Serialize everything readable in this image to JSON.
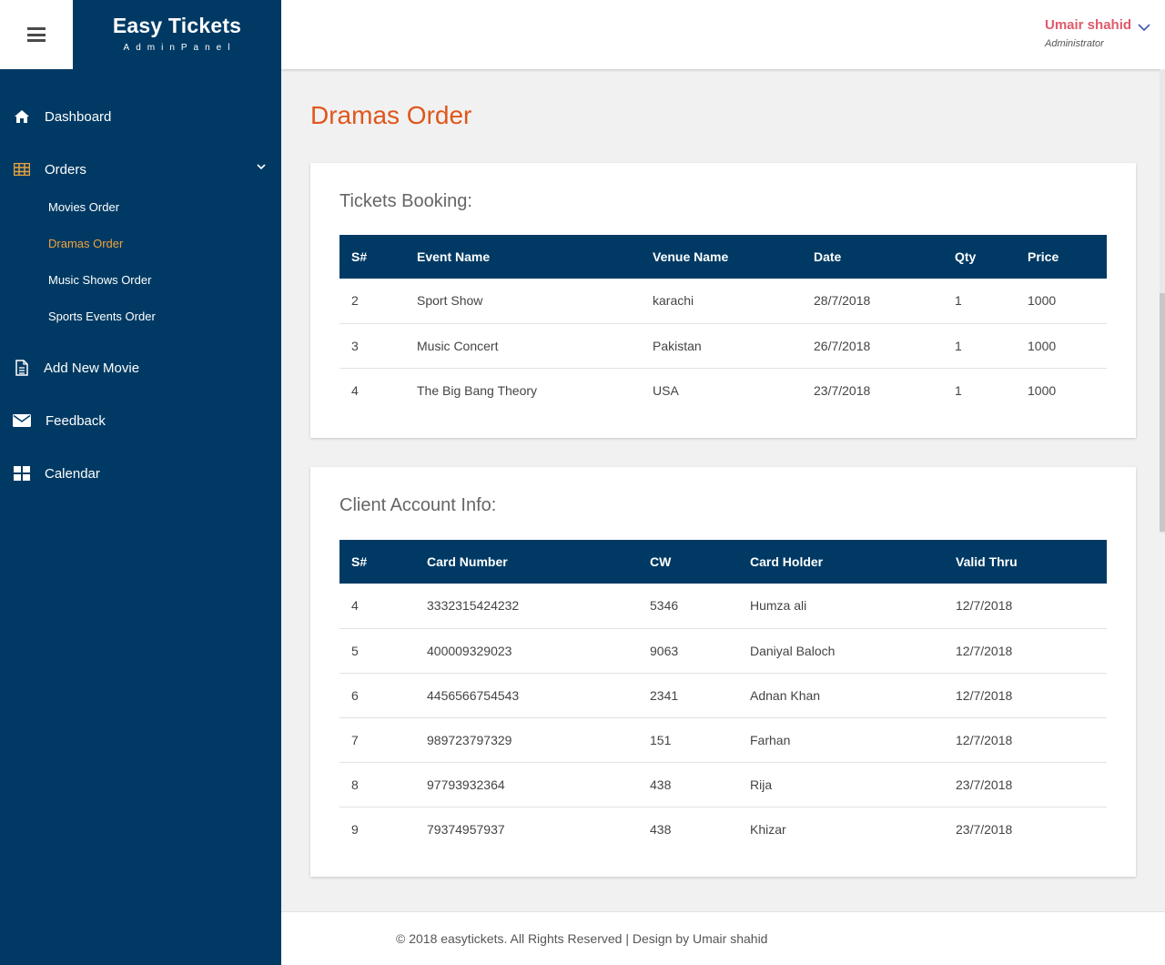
{
  "brand": {
    "title": "Easy Tickets",
    "subtitle": "AdminPanel"
  },
  "header": {
    "user_name": "Umair shahid",
    "user_role": "Administrator"
  },
  "sidebar": {
    "items": [
      {
        "label": "Dashboard",
        "icon": "home-icon"
      },
      {
        "label": "Orders",
        "icon": "table-icon"
      },
      {
        "label": "Add New Movie",
        "icon": "document-icon"
      },
      {
        "label": "Feedback",
        "icon": "envelope-icon"
      },
      {
        "label": "Calendar",
        "icon": "calendar-grid-icon"
      }
    ],
    "orders_sub": [
      {
        "label": "Movies Order"
      },
      {
        "label": "Dramas Order",
        "active": true
      },
      {
        "label": "Music Shows Order"
      },
      {
        "label": "Sports Events Order"
      }
    ]
  },
  "main": {
    "page_title": "Dramas Order",
    "bookings": {
      "title": "Tickets Booking:",
      "headers": [
        "S#",
        "Event Name",
        "Venue Name",
        "Date",
        "Qty",
        "Price"
      ],
      "rows": [
        [
          "2",
          "Sport Show",
          "karachi",
          "28/7/2018",
          "1",
          "1000"
        ],
        [
          "3",
          "Music Concert",
          "Pakistan",
          "26/7/2018",
          "1",
          "1000"
        ],
        [
          "4",
          "The Big Bang Theory",
          "USA",
          "23/7/2018",
          "1",
          "1000"
        ]
      ]
    },
    "clients": {
      "title": "Client Account Info:",
      "headers": [
        "S#",
        "Card Number",
        "CW",
        "Card Holder",
        "Valid Thru"
      ],
      "rows": [
        [
          "4",
          "3332315424232",
          "5346",
          "Humza ali",
          "12/7/2018"
        ],
        [
          "5",
          "400009329023",
          "9063",
          "Daniyal Baloch",
          "12/7/2018"
        ],
        [
          "6",
          "4456566754543",
          "2341",
          "Adnan Khan",
          "12/7/2018"
        ],
        [
          "7",
          "989723797329",
          "151",
          "Farhan",
          "12/7/2018"
        ],
        [
          "8",
          "97793932364",
          "438",
          "Rija",
          "23/7/2018"
        ],
        [
          "9",
          "79374957937",
          "438",
          "Khizar",
          "23/7/2018"
        ]
      ]
    }
  },
  "footer": {
    "text": "© 2018 easytickets. All Rights Reserved | Design by Umair shahid"
  },
  "colors": {
    "sidebar": "#003a64",
    "accent_orange": "#e0561b",
    "active_sub": "#f0a33a",
    "user_name": "#e05a6a"
  }
}
